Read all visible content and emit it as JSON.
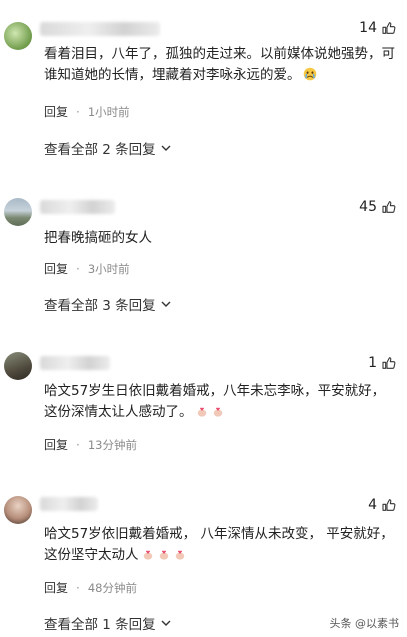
{
  "comments": [
    {
      "likes": "14",
      "text": "看着泪目，八年了，孤独的走过来。以前媒体说她强势，可谁知道她的长情，埋藏着对李咏永远的爱。",
      "reply_label": "回复",
      "time": "1小时前",
      "view_all": "查看全部 2 条回复"
    },
    {
      "likes": "45",
      "text": "把春晚搞砸的女人",
      "reply_label": "回复",
      "time": "3小时前",
      "view_all": "查看全部 3 条回复"
    },
    {
      "likes": "1",
      "text": "哈文57岁生日依旧戴着婚戒，八年未忘李咏，平安就好，这份深情太让人感动了。",
      "reply_label": "回复",
      "time": "13分钟前"
    },
    {
      "likes": "4",
      "text": "哈文57岁依旧戴着婚戒， 八年深情从未改变， 平安就好，这份坚守太动人",
      "reply_label": "回复",
      "time": "48分钟前",
      "view_all": "查看全部 1 条回复"
    }
  ],
  "watermark": "头条 @以素书",
  "icons": {
    "like": "thumbs-up-icon",
    "expand": "chevron-down-icon",
    "cry": "crying-face-icon",
    "heart_hand": "finger-heart-icon"
  }
}
